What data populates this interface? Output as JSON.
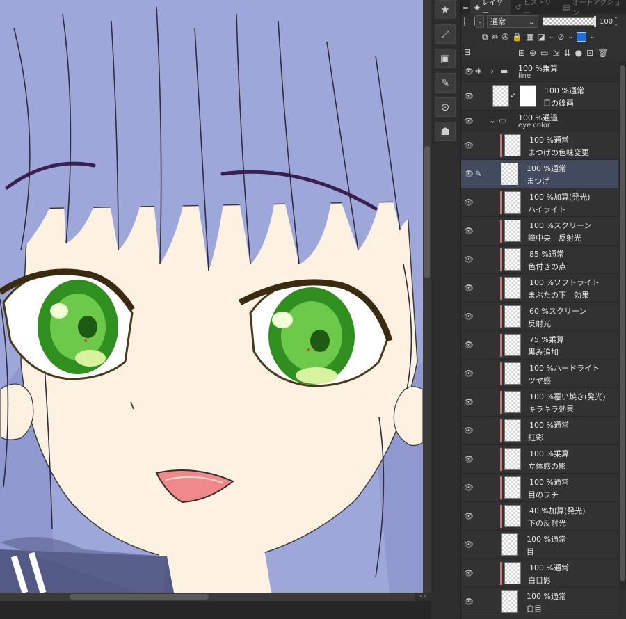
{
  "tabs": {
    "layer": "レイヤー",
    "history": "ヒストリー",
    "auto_action": "オートアクション"
  },
  "blend_mode_select": "通常",
  "opacity_value": "100",
  "layers": [
    {
      "opacity": "100 %乗算",
      "name": "line",
      "type": "folder",
      "state": "collapsed"
    },
    {
      "opacity": "100 %通常",
      "name": "目の線画",
      "type": "layer-with-mask"
    },
    {
      "opacity": "100 %通過",
      "name": "eye color",
      "type": "folder",
      "state": "expanded"
    },
    {
      "opacity": "100 %通常",
      "name": "まつげの色味変更",
      "clipped": true
    },
    {
      "opacity": "100 %通常",
      "name": "まつげ",
      "clipped": false,
      "selected": true
    },
    {
      "opacity": "100 %加算(発光)",
      "name": "ハイライト",
      "clipped": true
    },
    {
      "opacity": "100 %スクリーン",
      "name": "瞳中央　反射光",
      "clipped": true
    },
    {
      "opacity": "85 %通常",
      "name": "色付きの点",
      "clipped": true
    },
    {
      "opacity": "100 %ソフトライト",
      "name": "まぶたの下　効果",
      "clipped": true
    },
    {
      "opacity": "60 %スクリーン",
      "name": "反射光",
      "clipped": true
    },
    {
      "opacity": "75 %乗算",
      "name": "黒み追加",
      "clipped": true
    },
    {
      "opacity": "100 %ハードライト",
      "name": "ツヤ感",
      "clipped": true
    },
    {
      "opacity": "100 %覆い焼き(発光)",
      "name": "キラキラ効果",
      "clipped": true
    },
    {
      "opacity": "100 %通常",
      "name": "虹彩",
      "clipped": true
    },
    {
      "opacity": "100 %乗算",
      "name": "立体感の影",
      "clipped": true
    },
    {
      "opacity": "100 %通常",
      "name": "目のフチ",
      "clipped": true
    },
    {
      "opacity": "40 %加算(発光)",
      "name": "下の反射光",
      "clipped": true
    },
    {
      "opacity": "100 %通常",
      "name": "目",
      "clipped": false
    },
    {
      "opacity": "100 %通常",
      "name": "白目影",
      "clipped": true
    },
    {
      "opacity": "100 %通常",
      "name": "白目",
      "clipped": false
    }
  ],
  "colors": {
    "canvas_bg": "#9ea7d9",
    "skin": "#fdf1e2",
    "iris": "#2f8f1f",
    "selected_row": "#424b5e",
    "clip_bar": "#e0706a",
    "panel_bg": "#303030"
  }
}
